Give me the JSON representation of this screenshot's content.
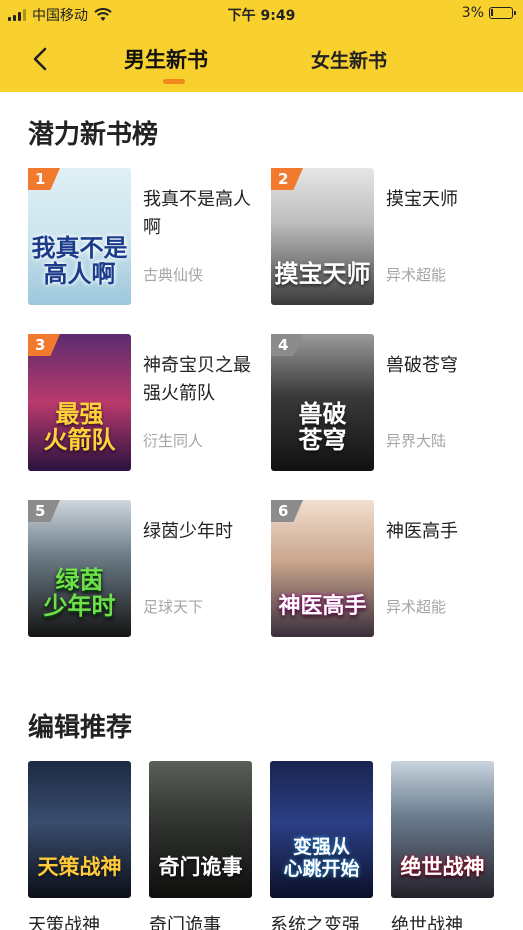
{
  "status": {
    "carrier": "中国移动",
    "time": "下午 9:49",
    "battery": "3%"
  },
  "nav": {
    "tabs": [
      {
        "label": "男生新书",
        "active": true
      },
      {
        "label": "女生新书",
        "active": false
      }
    ]
  },
  "potential": {
    "title": "潜力新书榜",
    "books": [
      {
        "rank": "1",
        "title": "我真不是高人啊",
        "genre": "古典仙侠",
        "cover_text": "我真不是\n高人啊",
        "rank_color": "#f27a2e"
      },
      {
        "rank": "2",
        "title": "摸宝天师",
        "genre": "异术超能",
        "cover_text": "摸宝天师",
        "rank_color": "#f27a2e"
      },
      {
        "rank": "3",
        "title": "神奇宝贝之最强火箭队",
        "genre": "衍生同人",
        "cover_text": "最强\n火箭队",
        "rank_color": "#f27a2e"
      },
      {
        "rank": "4",
        "title": "兽破苍穹",
        "genre": "异界大陆",
        "cover_text": "兽破\n苍穹",
        "rank_color": "#8c8c8c"
      },
      {
        "rank": "5",
        "title": "绿茵少年时",
        "genre": "足球天下",
        "cover_text": "绿茵\n少年时",
        "rank_color": "#8c8c8c"
      },
      {
        "rank": "6",
        "title": "神医高手",
        "genre": "异术超能",
        "cover_text": "神医高手",
        "rank_color": "#8c8c8c"
      }
    ]
  },
  "editor": {
    "title": "编辑推荐",
    "books": [
      {
        "title": "天策战神",
        "cover_text": "天策战神"
      },
      {
        "title": "奇门诡事",
        "cover_text": "奇门诡事"
      },
      {
        "title": "系统之变强",
        "cover_text": "变强从\n心跳开始"
      },
      {
        "title": "绝世战神",
        "cover_text": "绝世战神"
      }
    ]
  },
  "colors": {
    "header": "#f9d12f",
    "tab_indicator": "#f08a1c",
    "genre_text": "#a5a5a5"
  }
}
